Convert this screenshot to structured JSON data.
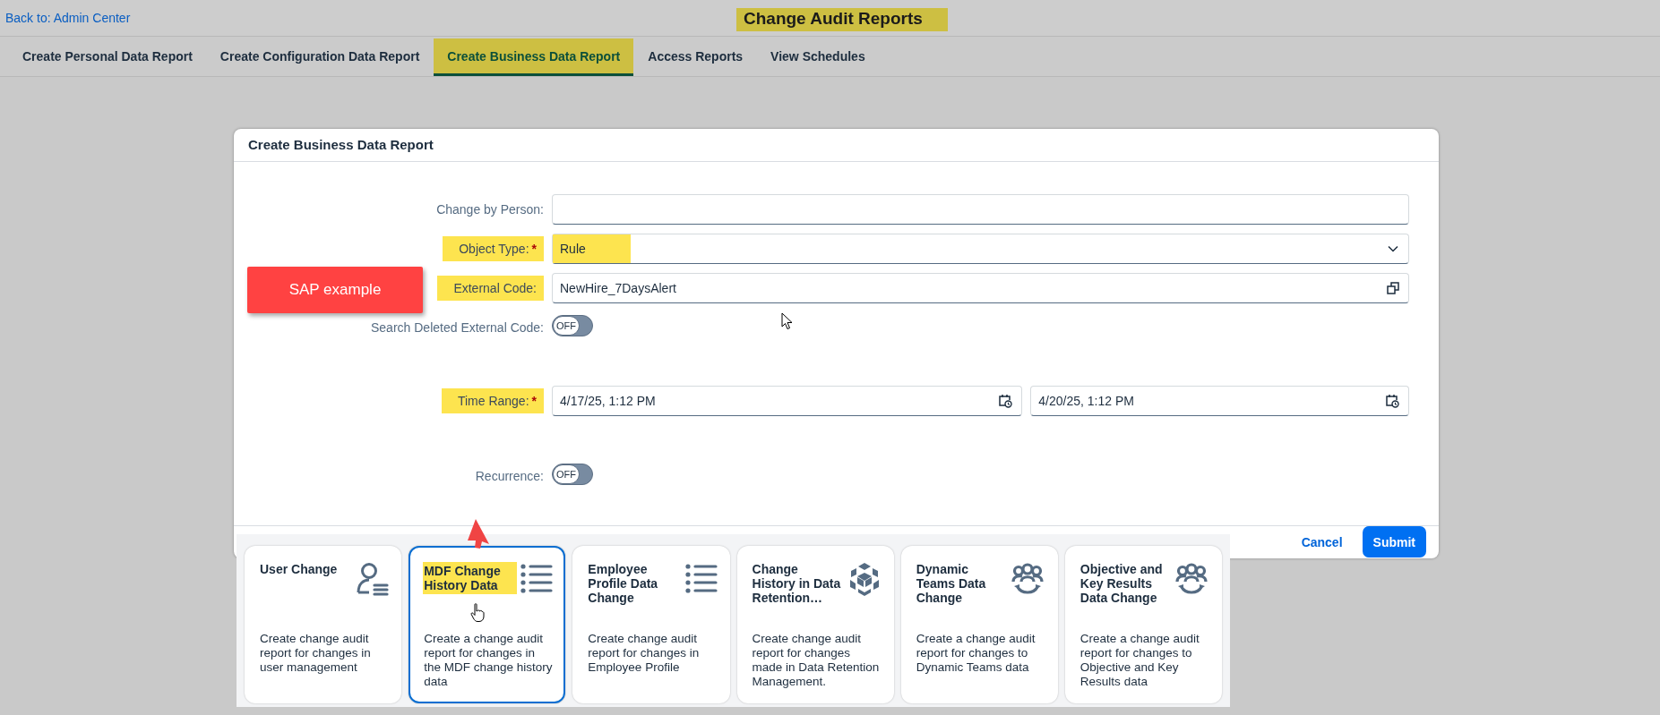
{
  "header": {
    "back_link": "Back to: Admin Center",
    "title": "Change Audit Reports",
    "title_highlighted": true
  },
  "tabs": [
    {
      "label": "Create Personal Data Report",
      "selected": false,
      "highlighted": false
    },
    {
      "label": "Create Configuration Data Report",
      "selected": false,
      "highlighted": false
    },
    {
      "label": "Create Business Data Report",
      "selected": true,
      "highlighted": true
    },
    {
      "label": "Access Reports",
      "selected": false,
      "highlighted": false
    },
    {
      "label": "View Schedules",
      "selected": false,
      "highlighted": false
    }
  ],
  "dialog": {
    "title": "Create Business Data Report",
    "fields": [
      {
        "kind": "text",
        "label": "Change by Person:",
        "highlighted": false
      },
      {
        "kind": "select",
        "label": "Object Type:",
        "required_mark": "*",
        "highlighted": true,
        "value": "Rule",
        "value_highlighted": true
      },
      {
        "kind": "lookup",
        "label": "External Code:",
        "highlighted": true,
        "value": "NewHire_7DaysAlert"
      },
      {
        "kind": "toggle",
        "label": "Search Deleted External Code:",
        "highlighted": false,
        "on": false,
        "toggle_text": "OFF"
      },
      {
        "kind": "daterange",
        "label": "Time Range:",
        "required_mark": "*",
        "highlighted": true,
        "values": [
          "4/17/25, 1:12 PM",
          "4/20/25, 1:12 PM"
        ]
      },
      {
        "kind": "toggle",
        "label": "Recurrence:",
        "highlighted": false,
        "on": false,
        "toggle_text": "OFF"
      }
    ],
    "buttons": [
      {
        "kind": "link",
        "label": "Cancel"
      },
      {
        "kind": "primary",
        "label": "Submit"
      }
    ]
  },
  "annotation": {
    "label": "SAP example"
  },
  "cards": [
    {
      "kind": "person-list",
      "title": "User Change",
      "title_highlighted": false,
      "selected": false,
      "description": "Create change audit report for changes in user management"
    },
    {
      "kind": "list",
      "title": "MDF Change History Data",
      "title_highlighted": true,
      "selected": true,
      "description": "Create a change audit report for changes in the MDF change history data"
    },
    {
      "kind": "list",
      "title": "Employee Profile Data Change",
      "title_highlighted": false,
      "selected": false,
      "description": "Create change audit report for changes in Employee Profile"
    },
    {
      "kind": "cube",
      "title": "Change History in Data Retention…",
      "title_highlighted": false,
      "selected": false,
      "description": "Create change audit report for changes made in Data Retention Management."
    },
    {
      "kind": "team-sync",
      "title": "Dynamic Teams Data Change",
      "title_highlighted": false,
      "selected": false,
      "description": "Create a change audit report for changes to Dynamic Teams data"
    },
    {
      "kind": "team-sync",
      "title": "Objective and Key Results Data Change",
      "title_highlighted": false,
      "selected": false,
      "description": "Create a change audit report for changes to Objective and Key Results data"
    }
  ]
}
